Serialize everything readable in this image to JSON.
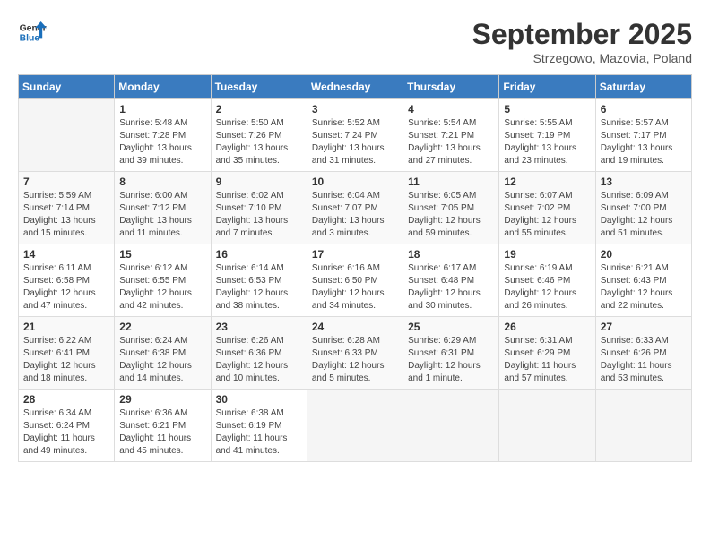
{
  "header": {
    "logo_line1": "General",
    "logo_line2": "Blue",
    "month": "September 2025",
    "location": "Strzegowo, Mazovia, Poland"
  },
  "days_of_week": [
    "Sunday",
    "Monday",
    "Tuesday",
    "Wednesday",
    "Thursday",
    "Friday",
    "Saturday"
  ],
  "weeks": [
    [
      {
        "num": "",
        "info": ""
      },
      {
        "num": "1",
        "info": "Sunrise: 5:48 AM\nSunset: 7:28 PM\nDaylight: 13 hours\nand 39 minutes."
      },
      {
        "num": "2",
        "info": "Sunrise: 5:50 AM\nSunset: 7:26 PM\nDaylight: 13 hours\nand 35 minutes."
      },
      {
        "num": "3",
        "info": "Sunrise: 5:52 AM\nSunset: 7:24 PM\nDaylight: 13 hours\nand 31 minutes."
      },
      {
        "num": "4",
        "info": "Sunrise: 5:54 AM\nSunset: 7:21 PM\nDaylight: 13 hours\nand 27 minutes."
      },
      {
        "num": "5",
        "info": "Sunrise: 5:55 AM\nSunset: 7:19 PM\nDaylight: 13 hours\nand 23 minutes."
      },
      {
        "num": "6",
        "info": "Sunrise: 5:57 AM\nSunset: 7:17 PM\nDaylight: 13 hours\nand 19 minutes."
      }
    ],
    [
      {
        "num": "7",
        "info": "Sunrise: 5:59 AM\nSunset: 7:14 PM\nDaylight: 13 hours\nand 15 minutes."
      },
      {
        "num": "8",
        "info": "Sunrise: 6:00 AM\nSunset: 7:12 PM\nDaylight: 13 hours\nand 11 minutes."
      },
      {
        "num": "9",
        "info": "Sunrise: 6:02 AM\nSunset: 7:10 PM\nDaylight: 13 hours\nand 7 minutes."
      },
      {
        "num": "10",
        "info": "Sunrise: 6:04 AM\nSunset: 7:07 PM\nDaylight: 13 hours\nand 3 minutes."
      },
      {
        "num": "11",
        "info": "Sunrise: 6:05 AM\nSunset: 7:05 PM\nDaylight: 12 hours\nand 59 minutes."
      },
      {
        "num": "12",
        "info": "Sunrise: 6:07 AM\nSunset: 7:02 PM\nDaylight: 12 hours\nand 55 minutes."
      },
      {
        "num": "13",
        "info": "Sunrise: 6:09 AM\nSunset: 7:00 PM\nDaylight: 12 hours\nand 51 minutes."
      }
    ],
    [
      {
        "num": "14",
        "info": "Sunrise: 6:11 AM\nSunset: 6:58 PM\nDaylight: 12 hours\nand 47 minutes."
      },
      {
        "num": "15",
        "info": "Sunrise: 6:12 AM\nSunset: 6:55 PM\nDaylight: 12 hours\nand 42 minutes."
      },
      {
        "num": "16",
        "info": "Sunrise: 6:14 AM\nSunset: 6:53 PM\nDaylight: 12 hours\nand 38 minutes."
      },
      {
        "num": "17",
        "info": "Sunrise: 6:16 AM\nSunset: 6:50 PM\nDaylight: 12 hours\nand 34 minutes."
      },
      {
        "num": "18",
        "info": "Sunrise: 6:17 AM\nSunset: 6:48 PM\nDaylight: 12 hours\nand 30 minutes."
      },
      {
        "num": "19",
        "info": "Sunrise: 6:19 AM\nSunset: 6:46 PM\nDaylight: 12 hours\nand 26 minutes."
      },
      {
        "num": "20",
        "info": "Sunrise: 6:21 AM\nSunset: 6:43 PM\nDaylight: 12 hours\nand 22 minutes."
      }
    ],
    [
      {
        "num": "21",
        "info": "Sunrise: 6:22 AM\nSunset: 6:41 PM\nDaylight: 12 hours\nand 18 minutes."
      },
      {
        "num": "22",
        "info": "Sunrise: 6:24 AM\nSunset: 6:38 PM\nDaylight: 12 hours\nand 14 minutes."
      },
      {
        "num": "23",
        "info": "Sunrise: 6:26 AM\nSunset: 6:36 PM\nDaylight: 12 hours\nand 10 minutes."
      },
      {
        "num": "24",
        "info": "Sunrise: 6:28 AM\nSunset: 6:33 PM\nDaylight: 12 hours\nand 5 minutes."
      },
      {
        "num": "25",
        "info": "Sunrise: 6:29 AM\nSunset: 6:31 PM\nDaylight: 12 hours\nand 1 minute."
      },
      {
        "num": "26",
        "info": "Sunrise: 6:31 AM\nSunset: 6:29 PM\nDaylight: 11 hours\nand 57 minutes."
      },
      {
        "num": "27",
        "info": "Sunrise: 6:33 AM\nSunset: 6:26 PM\nDaylight: 11 hours\nand 53 minutes."
      }
    ],
    [
      {
        "num": "28",
        "info": "Sunrise: 6:34 AM\nSunset: 6:24 PM\nDaylight: 11 hours\nand 49 minutes."
      },
      {
        "num": "29",
        "info": "Sunrise: 6:36 AM\nSunset: 6:21 PM\nDaylight: 11 hours\nand 45 minutes."
      },
      {
        "num": "30",
        "info": "Sunrise: 6:38 AM\nSunset: 6:19 PM\nDaylight: 11 hours\nand 41 minutes."
      },
      {
        "num": "",
        "info": ""
      },
      {
        "num": "",
        "info": ""
      },
      {
        "num": "",
        "info": ""
      },
      {
        "num": "",
        "info": ""
      }
    ]
  ]
}
